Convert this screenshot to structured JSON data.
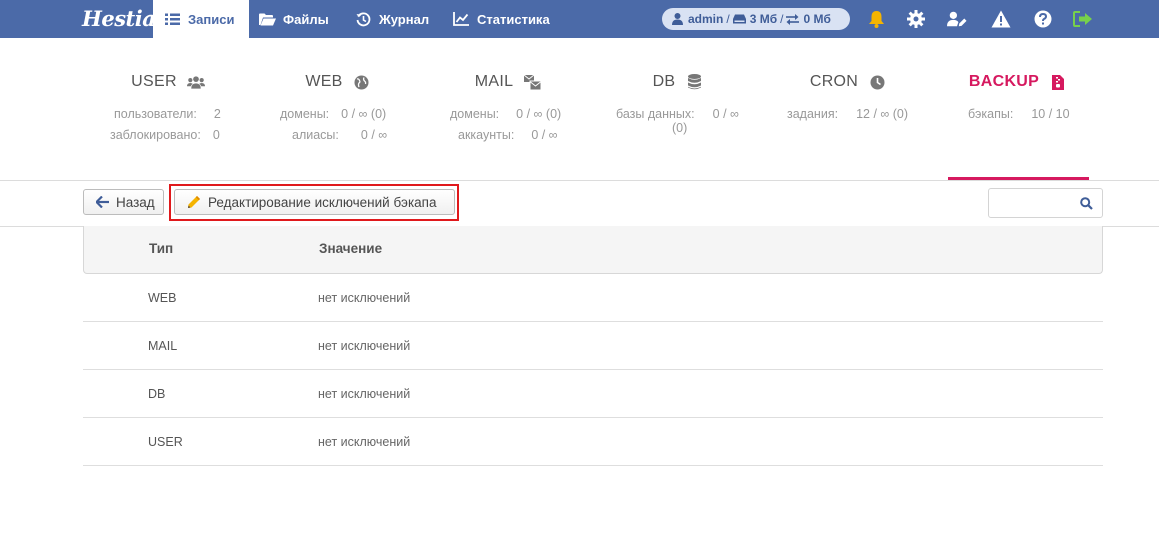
{
  "brand": {
    "logo_text": "Hestia"
  },
  "nav": {
    "tabs": [
      {
        "label": "Записи",
        "icon": "list-icon",
        "active": true
      },
      {
        "label": "Файлы",
        "icon": "folder-open-icon",
        "active": false
      },
      {
        "label": "Журнал",
        "icon": "history-icon",
        "active": false
      },
      {
        "label": "Статистика",
        "icon": "chart-line-icon",
        "active": false
      }
    ]
  },
  "user_status": {
    "username": "admin",
    "disk": "3 Мб",
    "bandwidth": "0 Мб",
    "separator": "/"
  },
  "stats": [
    {
      "title": "USER",
      "icon": "users-icon",
      "rows": [
        {
          "label": "пользователи:",
          "value": "2"
        },
        {
          "label": "заблокировано:",
          "value": "0"
        }
      ]
    },
    {
      "title": "WEB",
      "icon": "globe-icon",
      "rows": [
        {
          "label": "домены:",
          "value": "0 / ∞ (0)"
        },
        {
          "label": "алиасы:",
          "value": "0 / ∞"
        }
      ]
    },
    {
      "title": "MAIL",
      "icon": "mail-bulk-icon",
      "rows": [
        {
          "label": "домены:",
          "value": "0 / ∞ (0)"
        },
        {
          "label": "аккаунты:",
          "value": "0 / ∞"
        }
      ]
    },
    {
      "title": "DB",
      "icon": "database-icon",
      "rows": [
        {
          "label": "базы данных:",
          "label2": "(0)",
          "value": "0 / ∞"
        }
      ]
    },
    {
      "title": "CRON",
      "icon": "clock-icon",
      "rows": [
        {
          "label": "задания:",
          "value": "12 / ∞ (0)"
        }
      ]
    },
    {
      "title": "BACKUP",
      "icon": "file-archive-icon",
      "active": true,
      "rows": [
        {
          "label": "бэкапы:",
          "value": "10 / 10"
        }
      ]
    }
  ],
  "toolbar": {
    "back_label": "Назад",
    "edit_label": "Редактирование исключений бэкапа",
    "search_placeholder": ""
  },
  "table": {
    "headers": {
      "type": "Тип",
      "value": "Значение"
    },
    "rows": [
      {
        "type": "WEB",
        "value": "нет исключений"
      },
      {
        "type": "MAIL",
        "value": "нет исключений"
      },
      {
        "type": "DB",
        "value": "нет исключений"
      },
      {
        "type": "USER",
        "value": "нет исключений"
      }
    ]
  },
  "colors": {
    "topbar": "#4b6aa8",
    "accent": "#d6195f",
    "highlight": "#e0191c",
    "bell": "#f5b400",
    "logout": "#77d14b"
  }
}
